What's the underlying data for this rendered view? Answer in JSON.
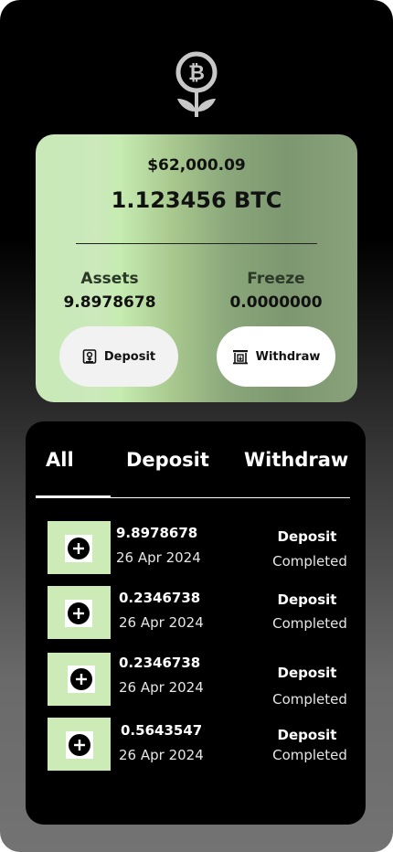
{
  "logo": {
    "icon": "bitcoin-flower-icon"
  },
  "balance": {
    "usd": "$62,000.09",
    "btc": "1.123456 BTC",
    "assets_label": "Assets",
    "assets_value": "9.8978678",
    "freeze_label": "Freeze",
    "freeze_value": "0.0000000",
    "deposit_label": "Deposit",
    "withdraw_label": "Withdraw"
  },
  "tabs": {
    "all": "All",
    "deposit": "Deposit",
    "withdraw": "Withdraw",
    "active": "All"
  },
  "transactions": [
    {
      "amount": "9.8978678",
      "date": "26 Apr 2024",
      "type": "Deposit",
      "status": "Completed"
    },
    {
      "amount": "0.2346738",
      "date": "26 Apr 2024",
      "type": "Deposit",
      "status": "Completed"
    },
    {
      "amount": "0.2346738",
      "date": "26 Apr 2024",
      "type": "Deposit",
      "status": "Completed"
    },
    {
      "amount": "0.5643547",
      "date": "26 Apr 2024",
      "type": "Deposit",
      "status": "Completed"
    }
  ],
  "colors": {
    "card_light_green": "#cdebb7",
    "card_dark_green": "#7d9770",
    "panel_black": "#000000"
  }
}
